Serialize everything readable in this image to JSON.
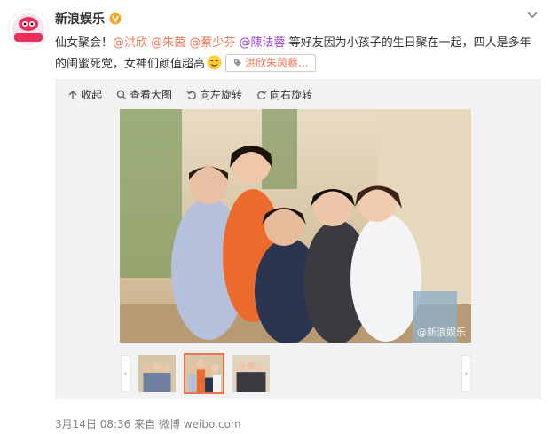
{
  "account": {
    "name": "新浪娱乐",
    "avatar_text": "新浪娱乐"
  },
  "post": {
    "text_1": "仙女聚会！",
    "mentions": [
      "@洪欣",
      "@朱茵",
      "@蔡少芬",
      "@陳法蓉"
    ],
    "text_2": " 等好友因为小孩子的生日聚在一起，四人是多年的闺蜜死党，女神们颜值超高",
    "tag_label": "洪欣朱茵蔡..."
  },
  "toolbar": {
    "collapse": "收起",
    "view_large": "查看大图",
    "rotate_left": "向左旋转",
    "rotate_right": "向右旋转"
  },
  "photo": {
    "watermark": "@新浪娱乐"
  },
  "gallery": {
    "prev_symbol": "‹",
    "next_symbol": "›",
    "selected_index": 2
  },
  "meta": {
    "timestamp": "3月14日 08:36",
    "source_prefix": "来自",
    "source": "微博 weibo.com"
  },
  "colors": {
    "mention": "#eb7350",
    "mention_purple": "#9b3fd1",
    "media_bg": "#f2f2f5"
  }
}
